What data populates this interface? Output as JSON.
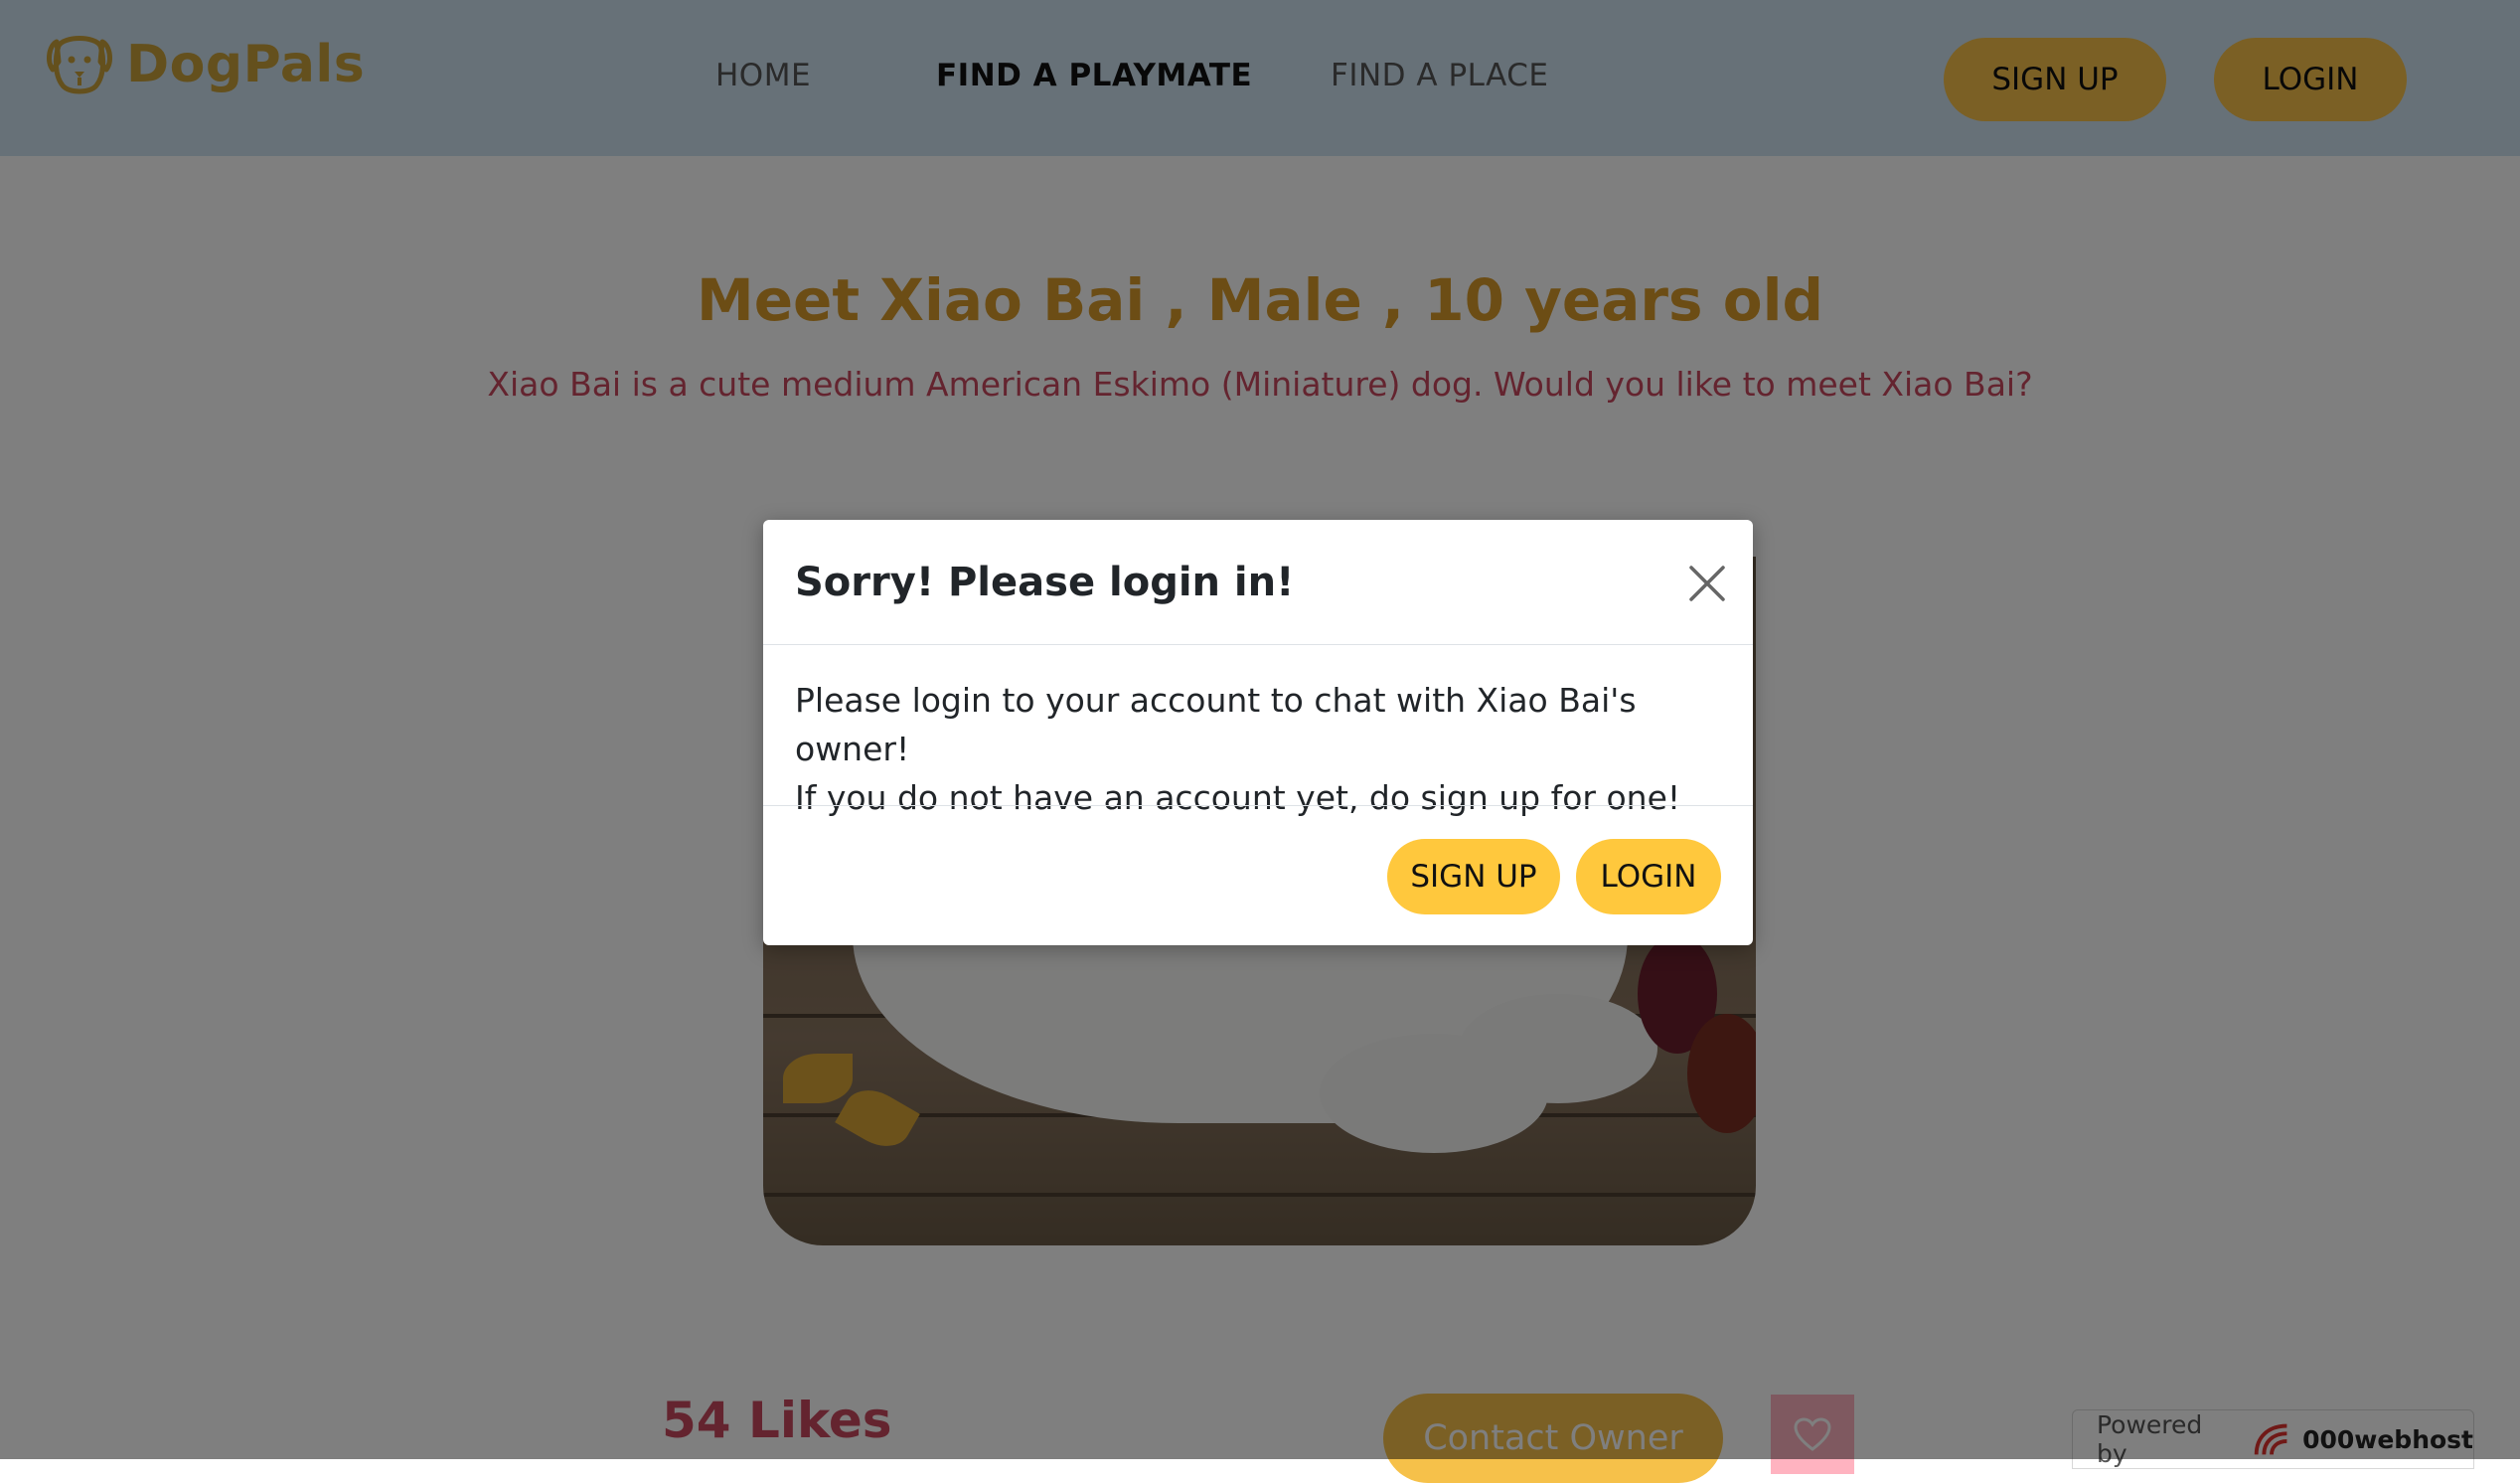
{
  "nav": {
    "brand": "DogPals",
    "links": [
      "HOME",
      "FIND A PLAYMATE",
      "FIND A PLACE"
    ],
    "signup_label": "SIGN UP",
    "login_label": "LOGIN"
  },
  "profile": {
    "title": "Meet Xiao Bai , Male , 10 years old",
    "subtitle": "Xiao Bai is a cute medium American Eskimo (Miniature) dog. Would you like to meet Xiao Bai?",
    "likes": "54 Likes",
    "contact_label": "Contact Owner"
  },
  "modal": {
    "title": "Sorry! Please login in!",
    "line1": "Please login to your account to chat with Xiao Bai's owner!",
    "line2": "If you do not have an account yet, do sign up for one!",
    "signup_label": "SIGN UP",
    "login_label": "LOGIN"
  },
  "footer": {
    "powered_prefix": "Powered by",
    "powered_brand": "000webhost"
  },
  "icons": {
    "logo": "dog-face-icon",
    "close": "close-icon",
    "like": "heart-icon",
    "host_logo": "webhost-logo-icon"
  },
  "colors": {
    "brand": "#c9a13a",
    "button": "#f6c14a",
    "accent_text": "#c8485f",
    "navbar_bg": "#cfe2f0"
  }
}
